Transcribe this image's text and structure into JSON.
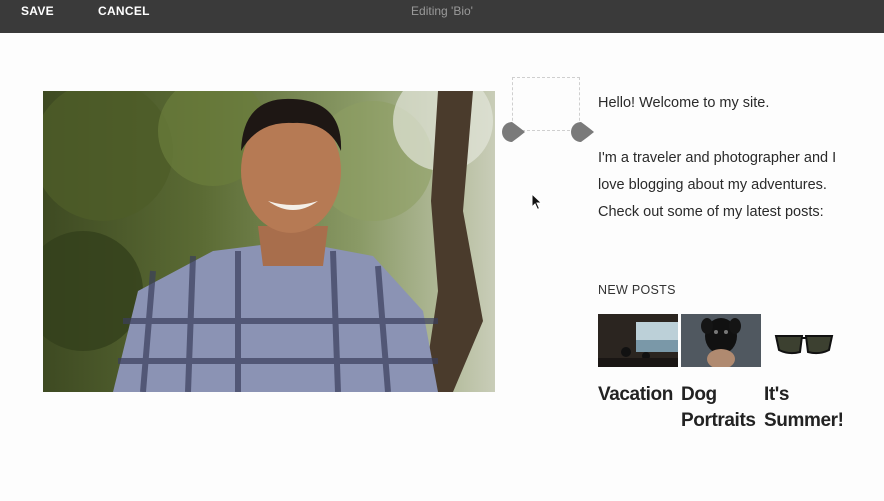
{
  "toolbar": {
    "save_label": "SAVE",
    "cancel_label": "CANCEL",
    "title": "Editing 'Bio'"
  },
  "bio": {
    "intro": "Hello! Welcome to my site.",
    "body": "I'm a traveler and photographer and I love blogging about my adventures. Check out some of my latest posts:"
  },
  "new_posts": {
    "heading": "NEW POSTS",
    "items": [
      {
        "title": "Vacation"
      },
      {
        "title_line1": "Dog",
        "title_line2": "Portraits"
      },
      {
        "title_line1": "It's",
        "title_line2": "Summer!"
      }
    ]
  },
  "colors": {
    "toolbar_bg": "#3a3a3a",
    "handle": "#7a7a7a"
  }
}
